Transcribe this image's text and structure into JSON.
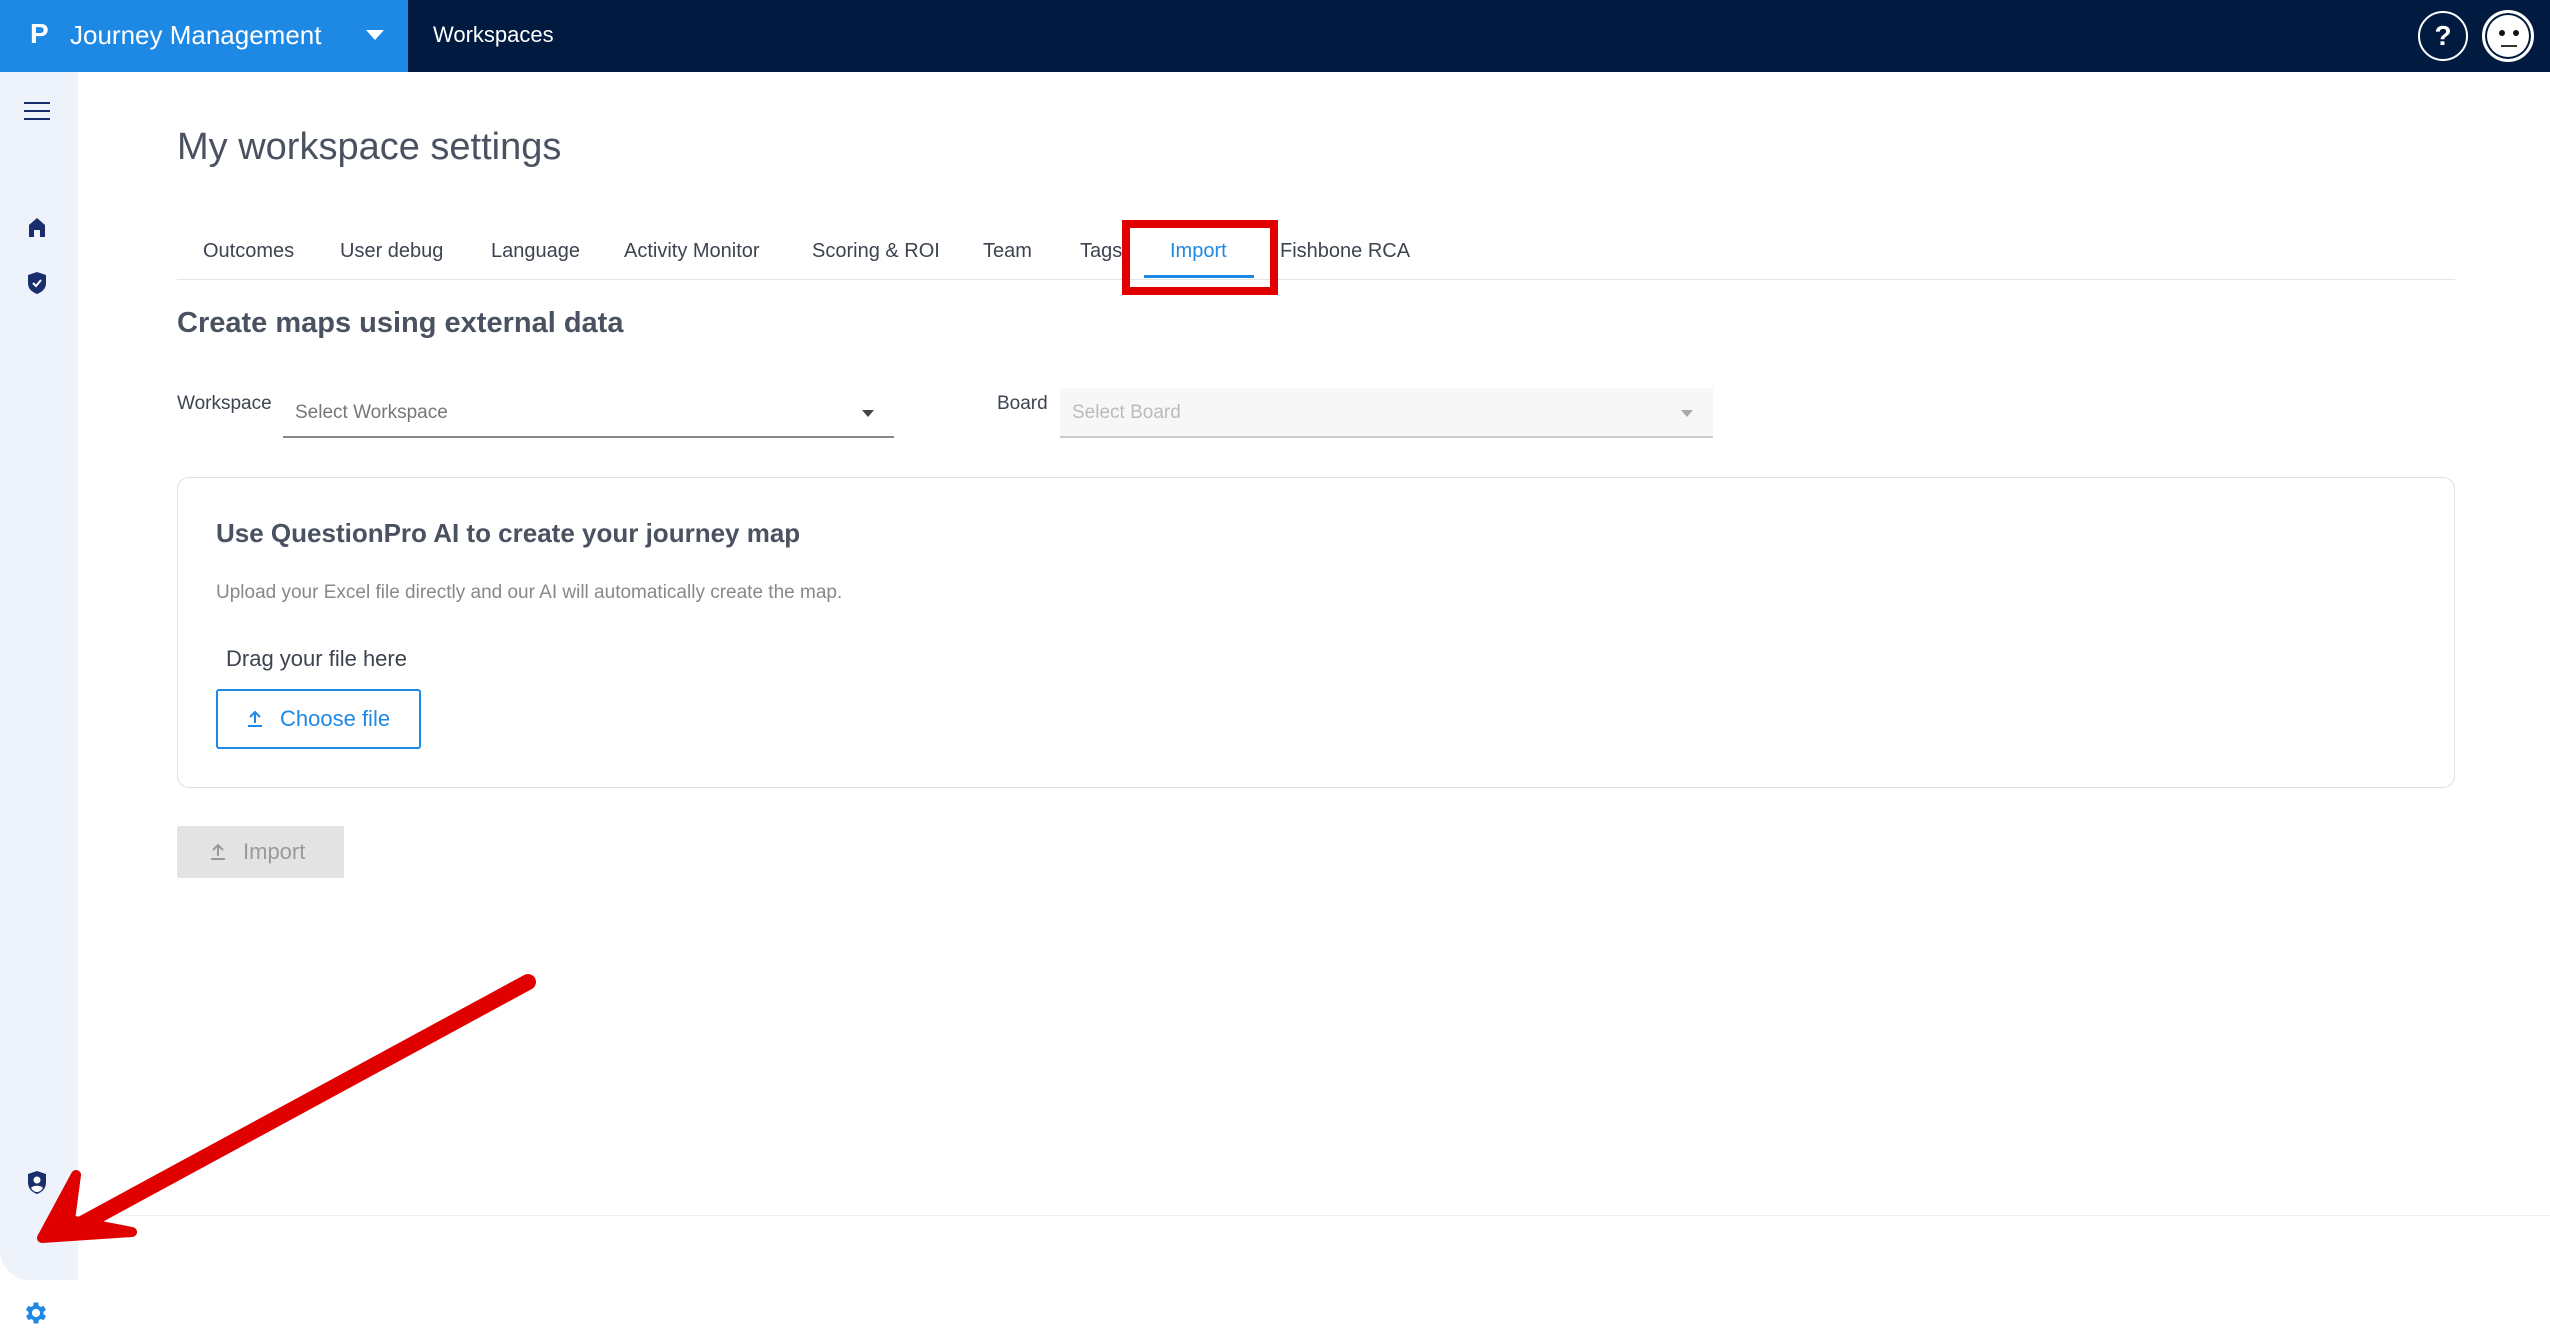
{
  "header": {
    "logo": "P",
    "app_title": "Journey Management",
    "section": "Workspaces",
    "help": "?"
  },
  "page": {
    "title": "My workspace settings"
  },
  "tabs": [
    {
      "label": "Outcomes"
    },
    {
      "label": "User debug"
    },
    {
      "label": "Language"
    },
    {
      "label": "Activity Monitor"
    },
    {
      "label": "Scoring & ROI"
    },
    {
      "label": "Team"
    },
    {
      "label": "Tags"
    },
    {
      "label": "Import",
      "active": true
    },
    {
      "label": "Fishbone RCA"
    }
  ],
  "import": {
    "heading": "Create maps using external data",
    "workspace_label": "Workspace",
    "workspace_placeholder": "Select Workspace",
    "board_label": "Board",
    "board_placeholder": "Select Board",
    "card": {
      "title": "Use QuestionPro AI to create your journey map",
      "subtitle": "Upload your Excel file directly and our AI will automatically create the map.",
      "drag_text": "Drag your file here",
      "choose_label": "Choose file"
    },
    "import_label": "Import"
  },
  "colors": {
    "brand": "#1e88e5",
    "header": "#011a40",
    "annotation": "#e00000"
  }
}
